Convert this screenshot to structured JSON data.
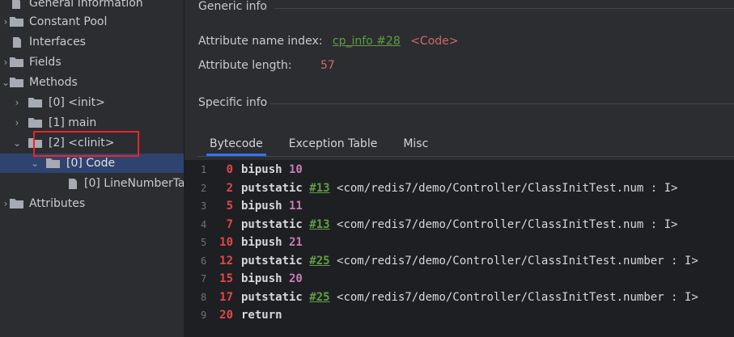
{
  "tree": {
    "items": [
      {
        "label": "General Information",
        "icon": "file-icon"
      },
      {
        "label": "Constant Pool",
        "icon": "folder-icon"
      },
      {
        "label": "Interfaces",
        "icon": "file-icon"
      },
      {
        "label": "Fields",
        "icon": "folder-icon"
      },
      {
        "label": "Methods",
        "icon": "folder-icon"
      },
      {
        "label": "[0] <init>",
        "icon": "folder-icon"
      },
      {
        "label": "[1] main",
        "icon": "folder-icon"
      },
      {
        "label": "[2] <clinit>",
        "icon": "folder-icon"
      },
      {
        "label": "[0] Code",
        "icon": "folder-icon"
      },
      {
        "label": "[0] LineNumberTab",
        "icon": "file-icon"
      },
      {
        "label": "Attributes",
        "icon": "folder-icon"
      }
    ],
    "selected_index": 8
  },
  "generic": {
    "title": "Generic info",
    "name_index_label": "Attribute name index:",
    "name_index_link": "cp_info #28",
    "name_index_value": "<Code>",
    "length_label": "Attribute length:",
    "length_value": "57"
  },
  "specific": {
    "title": "Specific info"
  },
  "tabs": [
    "Bytecode",
    "Exception Table",
    "Misc"
  ],
  "active_tab": "Bytecode",
  "bytecode": [
    {
      "line": "1",
      "offset": "0",
      "instr": "bipush",
      "arg": "10",
      "ref": "",
      "cls": ""
    },
    {
      "line": "2",
      "offset": "2",
      "instr": "putstatic",
      "arg": "",
      "ref": "#13",
      "cls": "<com/redis7/demo/Controller/ClassInitTest.num : I>"
    },
    {
      "line": "3",
      "offset": "5",
      "instr": "bipush",
      "arg": "11",
      "ref": "",
      "cls": ""
    },
    {
      "line": "4",
      "offset": "7",
      "instr": "putstatic",
      "arg": "",
      "ref": "#13",
      "cls": "<com/redis7/demo/Controller/ClassInitTest.num : I>"
    },
    {
      "line": "5",
      "offset": "10",
      "instr": "bipush",
      "arg": "21",
      "ref": "",
      "cls": ""
    },
    {
      "line": "6",
      "offset": "12",
      "instr": "putstatic",
      "arg": "",
      "ref": "#25",
      "cls": "<com/redis7/demo/Controller/ClassInitTest.number : I>"
    },
    {
      "line": "7",
      "offset": "15",
      "instr": "bipush",
      "arg": "20",
      "ref": "",
      "cls": ""
    },
    {
      "line": "8",
      "offset": "17",
      "instr": "putstatic",
      "arg": "",
      "ref": "#25",
      "cls": "<com/redis7/demo/Controller/ClassInitTest.number : I>"
    },
    {
      "line": "9",
      "offset": "20",
      "instr": "return",
      "arg": "",
      "ref": "",
      "cls": ""
    }
  ],
  "colors": {
    "accent": "#3574f0",
    "highlight_box": "#e5262a",
    "selection": "#2e436e"
  }
}
